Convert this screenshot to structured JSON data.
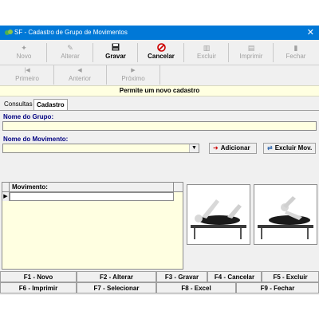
{
  "window": {
    "title": "SF - Cadastro de Grupo de Movimentos",
    "close_glyph": "✕"
  },
  "toolbar": {
    "buttons": [
      {
        "label": "Novo",
        "icon": "new-icon",
        "enabled": false
      },
      {
        "label": "Alterar",
        "icon": "edit-icon",
        "enabled": false
      },
      {
        "label": "Gravar",
        "icon": "save-icon",
        "enabled": true
      },
      {
        "label": "Cancelar",
        "icon": "cancel-icon",
        "enabled": true
      },
      {
        "label": "Excluir",
        "icon": "delete-icon",
        "enabled": false
      },
      {
        "label": "Imprimir",
        "icon": "print-icon",
        "enabled": false
      },
      {
        "label": "Fechar",
        "icon": "close-door-icon",
        "enabled": false
      }
    ]
  },
  "nav": {
    "buttons": [
      {
        "label": "Primeiro",
        "icon": "first-icon"
      },
      {
        "label": "Anterior",
        "icon": "prev-icon"
      },
      {
        "label": "Próximo",
        "icon": "next-icon"
      }
    ]
  },
  "status": {
    "text": "Permite um novo cadastro"
  },
  "tabs": [
    {
      "label": "Consultas",
      "active": false
    },
    {
      "label": "Cadastro",
      "active": true
    }
  ],
  "form": {
    "group_name_label": "Nome do Grupo:",
    "group_name_value": "",
    "movement_label": "Nome do Movimento:",
    "movement_value": "",
    "add_button": "Adicionar",
    "remove_button": "Excluir Mov.",
    "grid_header": "Movimento:"
  },
  "colors": {
    "titlebar": "#0078d7",
    "field_bg": "#ffffe1",
    "label": "#000080",
    "accent_red": "#cc0000"
  },
  "fkeys": {
    "row1": [
      "F1 - Novo",
      "F2 - Alterar",
      "F3 - Gravar",
      "F4 - Cancelar",
      "F5 - Excluir"
    ],
    "row2": [
      "F6 - Imprimir",
      "F7 - Selecionar",
      "F8 - Excel",
      "F9 - Fechar"
    ]
  }
}
